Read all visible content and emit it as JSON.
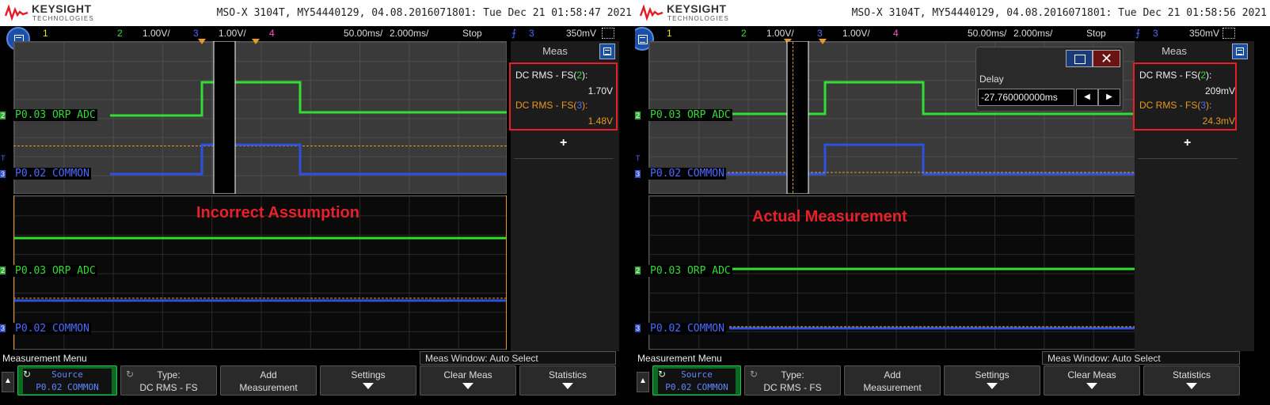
{
  "scopes": [
    {
      "header": {
        "brand": "KEYSIGHT",
        "brand_sub": "TECHNOLOGIES",
        "info": "MSO-X 3104T, MY54440129, 04.08.2016071801: Tue Dec 21 01:58:47 2021"
      },
      "channel_bar": {
        "ch1": "1",
        "ch2": "2",
        "ch2_scale": "1.00V/",
        "ch3": "3",
        "ch3_scale": "1.00V/",
        "ch4": "4",
        "timebase": "50.00ms/",
        "zoom_timebase": "2.000ms/",
        "run_state": "Stop",
        "trig_ch": "3",
        "trig_level": "350mV"
      },
      "traces": {
        "ch2_label": "P0.03 ORP ADC",
        "ch3_label": "P0.02 COMMON",
        "ch2_marker": "2",
        "ch3_marker": "3",
        "trig_marker": "T"
      },
      "annotation": "Incorrect Assumption",
      "meas": {
        "title": "Meas",
        "m1_name_pre": "DC RMS - FS(",
        "m1_ch": "2",
        "m1_name_post": "):",
        "m1_value": "1.70V",
        "m2_name_pre": "DC RMS - FS(",
        "m2_ch": "3",
        "m2_name_post": "):",
        "m2_value": "1.48V",
        "add": "+"
      },
      "menu": {
        "title": "Measurement Menu",
        "window": "Meas Window: Auto Select",
        "source": "Source",
        "source_value": "P0.02 COMMON",
        "type": "Type:",
        "type_value": "DC RMS - FS",
        "add_1": "Add",
        "add_2": "Measurement",
        "settings": "Settings",
        "clear": "Clear Meas",
        "statistics": "Statistics"
      }
    },
    {
      "header": {
        "brand": "KEYSIGHT",
        "brand_sub": "TECHNOLOGIES",
        "info": "MSO-X 3104T, MY54440129, 04.08.2016071801: Tue Dec 21 01:58:56 2021"
      },
      "channel_bar": {
        "ch1": "1",
        "ch2": "2",
        "ch2_scale": "1.00V/",
        "ch3": "3",
        "ch3_scale": "1.00V/",
        "ch4": "4",
        "timebase": "50.00ms/",
        "zoom_timebase": "2.000ms/",
        "run_state": "Stop",
        "trig_ch": "3",
        "trig_level": "350mV"
      },
      "traces": {
        "ch2_label": "P0.03 ORP ADC",
        "ch3_label": "P0.02 COMMON",
        "ch2_marker": "2",
        "ch3_marker": "3",
        "trig_marker": "T"
      },
      "annotation": "Actual Measurement",
      "delay": {
        "label": "Delay",
        "value": "-27.760000000ms"
      },
      "meas": {
        "title": "Meas",
        "m1_name_pre": "DC RMS - FS(",
        "m1_ch": "2",
        "m1_name_post": "):",
        "m1_value": "209mV",
        "m2_name_pre": "DC RMS - FS(",
        "m2_ch": "3",
        "m2_name_post": "):",
        "m2_value": "24.3mV",
        "add": "+"
      },
      "menu": {
        "title": "Measurement Menu",
        "window": "Meas Window: Auto Select",
        "source": "Source",
        "source_value": "P0.02 COMMON",
        "type": "Type:",
        "type_value": "DC RMS - FS",
        "add_1": "Add",
        "add_2": "Measurement",
        "settings": "Settings",
        "clear": "Clear Meas",
        "statistics": "Statistics"
      }
    }
  ],
  "colors": {
    "ch1": "#e8e800",
    "ch2": "#33dd33",
    "ch3": "#4a6bff",
    "ch4": "#ff55cc",
    "trigger": "#e89a20",
    "highlight": "#e81e28",
    "annotation": "#e8202a"
  }
}
